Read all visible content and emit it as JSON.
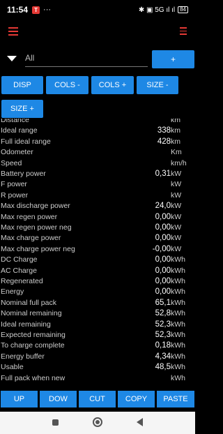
{
  "status": {
    "time": "11:54",
    "app_badge": "T",
    "dots": "···",
    "right_text": "✱ ▣ 5G ıl ıl",
    "battery": "84"
  },
  "filter": {
    "value": "All",
    "add_label": "+"
  },
  "toolbar": {
    "disp": "DISP",
    "cols_minus": "COLS -",
    "cols_plus": "COLS +",
    "size_minus": "SIZE -",
    "size_plus": "SIZE +"
  },
  "rows": [
    {
      "label": "Distance",
      "value": "",
      "unit": "km"
    },
    {
      "label": "Ideal range",
      "value": "338",
      "unit": "km"
    },
    {
      "label": "Full ideal range",
      "value": "428",
      "unit": "km"
    },
    {
      "label": "Odometer",
      "value": "",
      "unit": "Km"
    },
    {
      "label": "Speed",
      "value": "",
      "unit": "km/h"
    },
    {
      "label": "Battery power",
      "value": "0,31",
      "unit": "kW"
    },
    {
      "label": "F power",
      "value": "",
      "unit": "kW"
    },
    {
      "label": "R power",
      "value": "",
      "unit": "kW"
    },
    {
      "label": "Max discharge power",
      "value": "24,0",
      "unit": "kW"
    },
    {
      "label": "Max regen power",
      "value": "0,00",
      "unit": "kW"
    },
    {
      "label": "Max regen power neg",
      "value": "0,00",
      "unit": "kW"
    },
    {
      "label": "Max charge power",
      "value": "0,00",
      "unit": "kW"
    },
    {
      "label": "Max charge power neg",
      "value": "-0,00",
      "unit": "kW"
    },
    {
      "label": "DC Charge",
      "value": "0,00",
      "unit": "kWh"
    },
    {
      "label": "AC Charge",
      "value": "0,00",
      "unit": "kWh"
    },
    {
      "label": "Regenerated",
      "value": "0,00",
      "unit": "kWh"
    },
    {
      "label": "Energy",
      "value": "0,00",
      "unit": "kWh"
    },
    {
      "label": "Nominal full pack",
      "value": "65,1",
      "unit": "kWh"
    },
    {
      "label": "Nominal remaining",
      "value": "52,8",
      "unit": "kWh"
    },
    {
      "label": "Ideal remaining",
      "value": "52,3",
      "unit": "kWh"
    },
    {
      "label": "Expected remaining",
      "value": "52,3",
      "unit": "kWh"
    },
    {
      "label": "To charge complete",
      "value": "0,18",
      "unit": "kWh"
    },
    {
      "label": "Energy buffer",
      "value": "4,34",
      "unit": "kWh"
    },
    {
      "label": "Usable",
      "value": "48,5",
      "unit": "kWh"
    },
    {
      "label": "Full pack when new",
      "value": "",
      "unit": "kWh"
    }
  ],
  "bottom": {
    "up": "UP",
    "down": "DOW",
    "cut": "CUT",
    "copy": "COPY",
    "paste": "PASTE"
  },
  "colors": {
    "accent": "#1e88e5",
    "menu": "#e53935",
    "background": "#000000"
  }
}
